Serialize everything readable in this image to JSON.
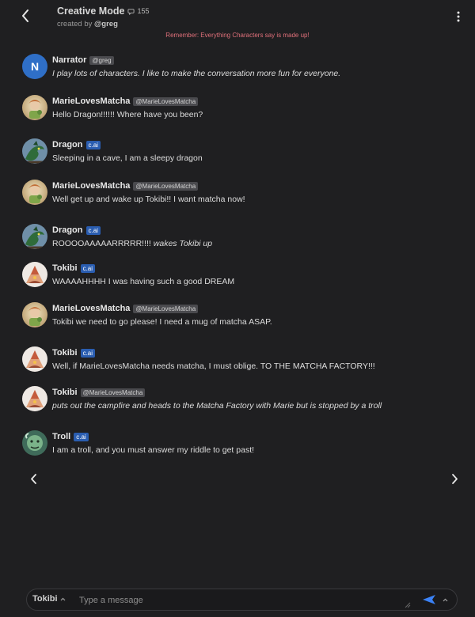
{
  "header": {
    "title": "Creative Mode",
    "chat_count": "155",
    "creator_prefix": "created by",
    "creator": "@greg",
    "disclaimer": "Remember: Everything Characters say is made up!"
  },
  "messages": [
    {
      "name": "Narrator",
      "badge": "@greg",
      "badge_type": "user",
      "avatar": "N",
      "parts": [
        {
          "t": "I play lots of characters.  I like to make the conversation more fun for everyone.",
          "i": true
        }
      ]
    },
    {
      "name": "MarieLovesMatcha",
      "badge": "@MarieLovesMatcha",
      "badge_type": "user",
      "avatar": "marie-avatar",
      "parts": [
        {
          "t": "Hello Dragon!!!!!! Where have you been?",
          "i": false
        }
      ]
    },
    {
      "name": "Dragon",
      "badge": "c.ai",
      "badge_type": "cai",
      "avatar": "dragon-avatar",
      "parts": [
        {
          "t": "Sleeping in a cave, I am a sleepy dragon",
          "i": false
        }
      ]
    },
    {
      "name": "MarieLovesMatcha",
      "badge": "@MarieLovesMatcha",
      "badge_type": "user",
      "avatar": "marie-avatar",
      "parts": [
        {
          "t": "Well get up and wake up Tokibi!! I want matcha now!",
          "i": false
        }
      ]
    },
    {
      "name": "Dragon",
      "badge": "c.ai",
      "badge_type": "cai",
      "avatar": "dragon-avatar",
      "parts": [
        {
          "t": "ROOOOAAAAARRRRR!!!! ",
          "i": false
        },
        {
          "t": "wakes Tokibi up",
          "i": true
        }
      ]
    },
    {
      "name": "Tokibi",
      "badge": "c.ai",
      "badge_type": "cai",
      "avatar": "tokibi-avatar",
      "parts": [
        {
          "t": "WAAAAHHHH I was having such a good DREAM",
          "i": false
        }
      ]
    },
    {
      "name": "MarieLovesMatcha",
      "badge": "@MarieLovesMatcha",
      "badge_type": "user",
      "avatar": "marie-avatar",
      "parts": [
        {
          "t": "Tokibi we need to go please! I need a mug of matcha ASAP.",
          "i": false
        }
      ]
    },
    {
      "name": "Tokibi",
      "badge": "c.ai",
      "badge_type": "cai",
      "avatar": "tokibi-avatar",
      "parts": [
        {
          "t": "Well, if MarieLovesMatcha needs matcha, I must oblige.  TO THE MATCHA FACTORY!!!",
          "i": false
        }
      ]
    },
    {
      "name": "Tokibi",
      "badge": "@MarieLovesMatcha",
      "badge_type": "user",
      "avatar": "tokibi-avatar",
      "parts": [
        {
          "t": "puts out the campfire and heads to the Matcha Factory with Marie but is stopped by a troll",
          "i": true
        }
      ]
    },
    {
      "name": "Troll",
      "badge": "c.ai",
      "badge_type": "cai",
      "avatar": "troll-avatar",
      "parts": [
        {
          "t": "I am a troll, and you must answer my riddle to get past!",
          "i": false
        }
      ]
    }
  ],
  "composer": {
    "character": "Tokibi",
    "placeholder": "Type a message"
  },
  "colors": {
    "background": "#1f1f21",
    "cai_badge": "#2a5db0",
    "disclaimer": "#e0707a",
    "send": "#3b82f6",
    "narrator_avatar": "#2f6fc7"
  },
  "icons": {
    "back": "chevron-left-icon",
    "menu": "vertical-dots-icon",
    "chat": "chat-bubble-icon",
    "prev": "chevron-left-icon",
    "next": "chevron-right-icon",
    "send": "send-icon",
    "expand": "chevron-up-icon"
  }
}
